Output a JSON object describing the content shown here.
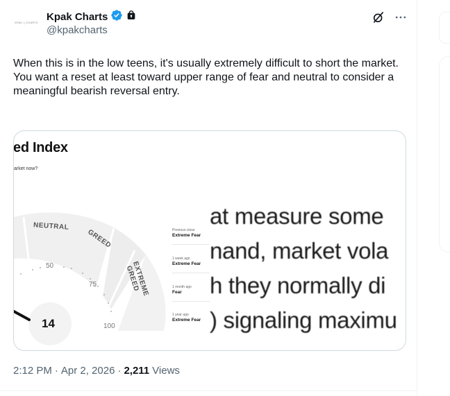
{
  "author": {
    "avatar_text": "ΚΡΑΚ ¦¦ CHARTS",
    "display_name": "Kpak Charts",
    "handle": "@kpakcharts",
    "verified_icon": "verified-badge-icon",
    "lock_icon": "lock-icon",
    "verified_color": "#1d9bf0"
  },
  "header_actions": {
    "grok_icon": "grok-icon",
    "more_icon": "more-icon"
  },
  "tweet": {
    "lines": [
      "When this is in the low teens, it's usually extremely difficult to short the market.",
      "You want a reset at least toward upper range of fear and neutral to consider a meaningful bearish reversal entry."
    ]
  },
  "media": {
    "title": "ed Index",
    "subtitle": "arket now?",
    "gauge": {
      "value": "14",
      "segment_labels": [
        "NEUTRAL",
        "GREED",
        "EXTREME GREED"
      ],
      "scale_labels": [
        "50",
        "75",
        "100"
      ]
    },
    "history": [
      {
        "label": "Previous close",
        "value": "Extreme Fear"
      },
      {
        "label": "1 week ago",
        "value": "Extreme Fear"
      },
      {
        "label": "1 month ago",
        "value": "Fear"
      },
      {
        "label": "1 year ago",
        "value": "Extreme Fear"
      }
    ],
    "enlarged_text_lines": [
      "at measure some",
      "nand, market vola",
      "h they normally di",
      ") signaling maximu"
    ]
  },
  "meta": {
    "time": "2:12 PM",
    "separator": "·",
    "date": "Apr 2, 2026",
    "views_count": "2,211",
    "views_label": "Views"
  }
}
